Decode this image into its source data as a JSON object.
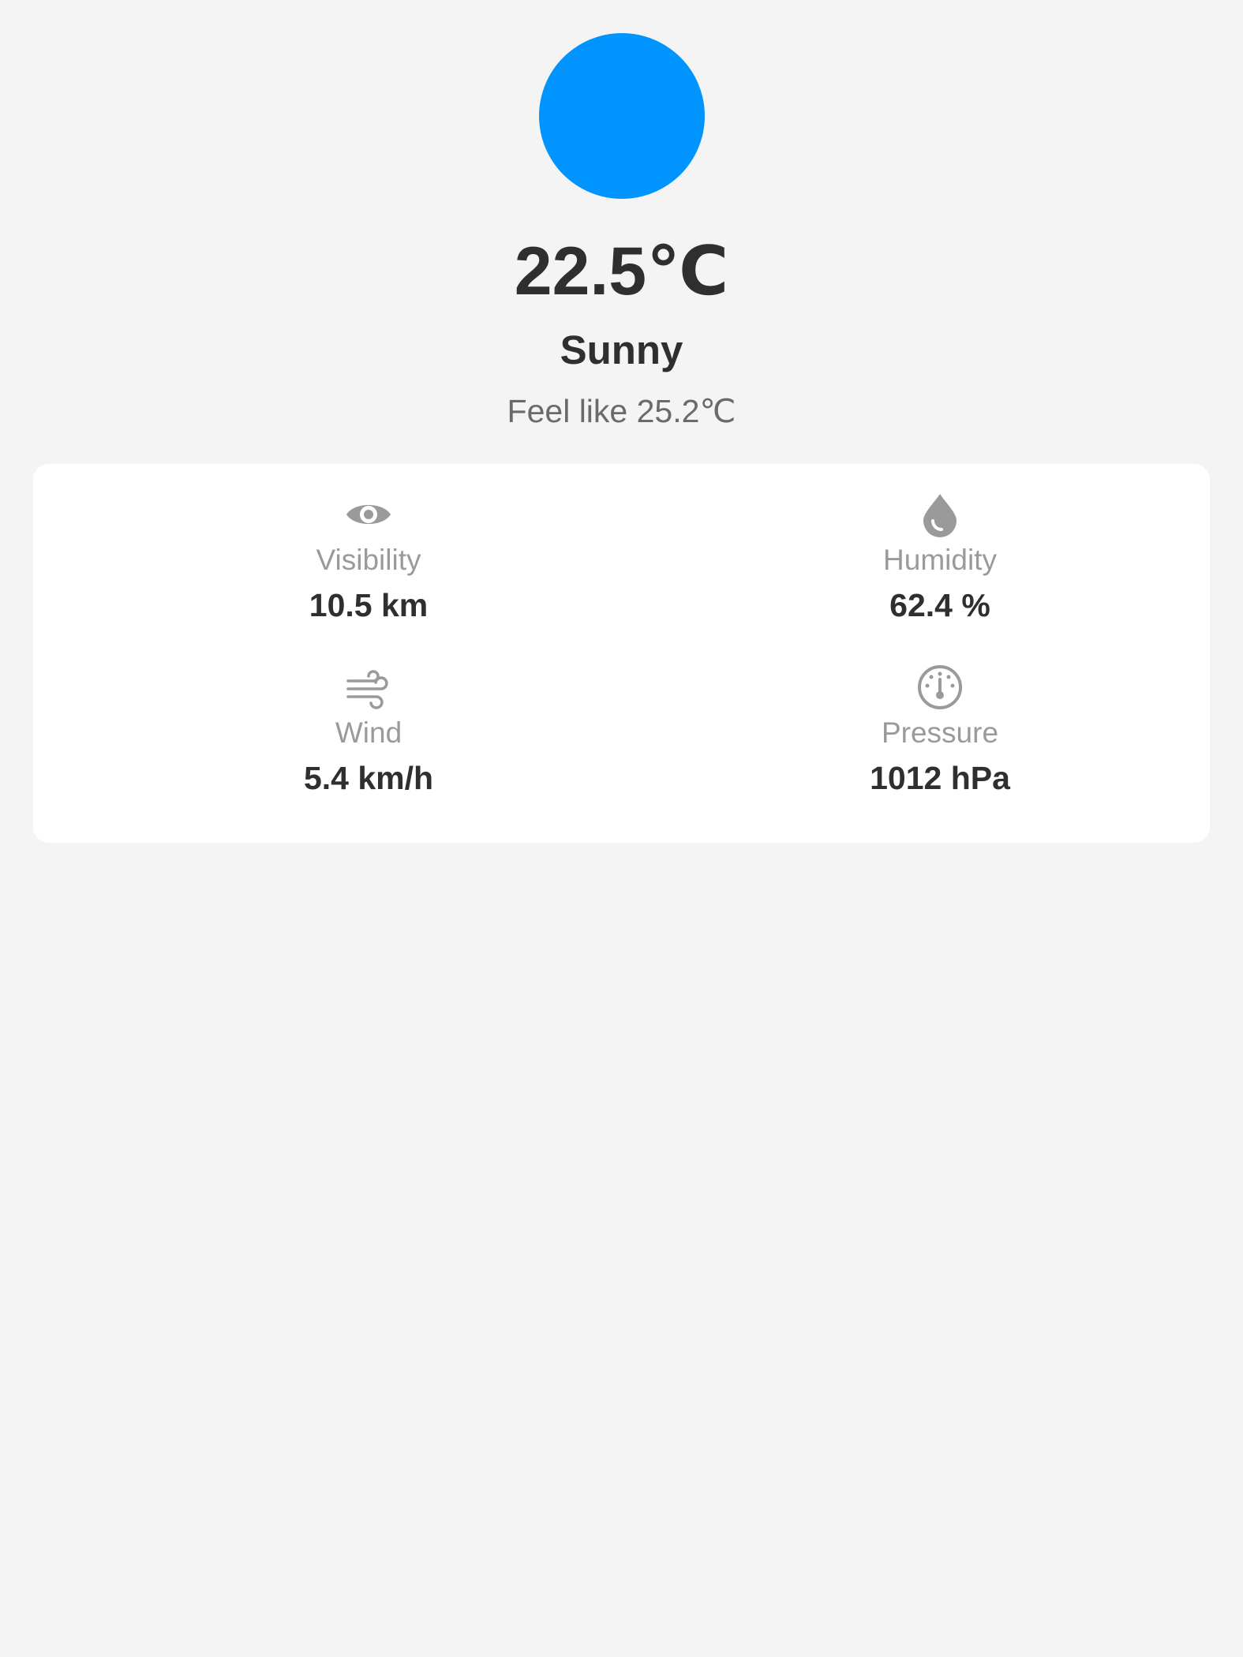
{
  "current": {
    "temperature": "22.5℃",
    "condition": "Sunny",
    "feels_like": "Feel like 25.2℃",
    "icon": "sun-icon",
    "icon_color": "#0094ff"
  },
  "details": {
    "visibility": {
      "label": "Visibility",
      "value": "10.5 km",
      "icon": "eye-icon"
    },
    "humidity": {
      "label": "Humidity",
      "value": "62.4 %",
      "icon": "water-drop-icon"
    },
    "wind": {
      "label": "Wind",
      "value": "5.4 km/h",
      "icon": "wind-icon"
    },
    "pressure": {
      "label": "Pressure",
      "value": "1012 hPa",
      "icon": "gauge-icon"
    }
  },
  "colors": {
    "background": "#f4f4f4",
    "card": "#ffffff",
    "primary_text": "#2f2f2f",
    "secondary_text": "#6a6a6a",
    "icon_gray": "#9a9a9a"
  }
}
